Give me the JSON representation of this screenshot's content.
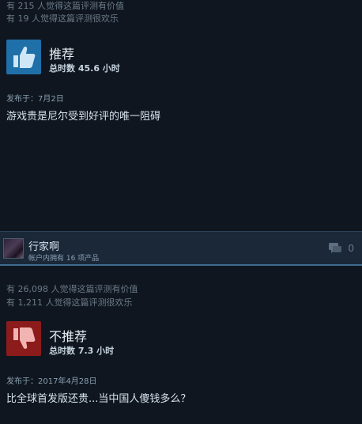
{
  "review1": {
    "helpful_line": "有 215 人觉得这篇评测有价值",
    "funny_line": "有 19 人觉得这篇评测很欢乐",
    "verdict": "推荐",
    "hours": "总时数 45.6 小时",
    "posted": "发布于：7月2日",
    "text": "游戏贵是尼尔受到好评的唯一阻碍"
  },
  "user": {
    "name": "行家啊",
    "products": "帐户内拥有 16 项产品",
    "comment_count": "0"
  },
  "review2": {
    "helpful_line": "有 26,098 人觉得这篇评测有价值",
    "funny_line": "有 1,211 人觉得这篇评测很欢乐",
    "verdict": "不推荐",
    "hours": "总时数 7.3 小时",
    "posted": "发布于：2017年4月28日",
    "text": "比全球首发版还贵...当中国人傻钱多么？"
  },
  "colors": {
    "thumbs_up_bg": "#1f6fa8",
    "thumbs_down_bg": "#8c1b1b",
    "page_bg": "#0f161f"
  },
  "icons": {
    "thumbs_up": "thumbs-up-icon",
    "thumbs_down": "thumbs-down-icon",
    "comment": "comment-icon"
  }
}
